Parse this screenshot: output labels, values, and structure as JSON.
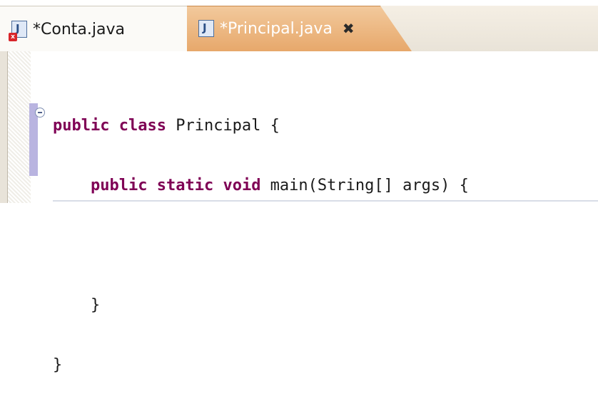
{
  "tabs": [
    {
      "label": "*Conta.java",
      "icon": "java-file-error-icon",
      "active": false
    },
    {
      "label": "*Principal.java",
      "icon": "java-file-icon",
      "active": true,
      "close_glyph": "✖"
    }
  ],
  "icon_glyph": "J",
  "error_glyph": "x",
  "code": {
    "lines": [
      {
        "kw1": "public",
        "kw2": "class",
        "rest": " Principal {"
      },
      {
        "indent": "    ",
        "kw1": "public",
        "kw2": "static",
        "kw3": "void",
        "rest": " main(String[] args) {"
      },
      {
        "text": ""
      },
      {
        "text": "    }"
      },
      {
        "text": "}"
      }
    ]
  },
  "colors": {
    "keyword": "#7f0055",
    "active_tab": "#e7a86b",
    "change_bar": "#b9b4e0"
  }
}
